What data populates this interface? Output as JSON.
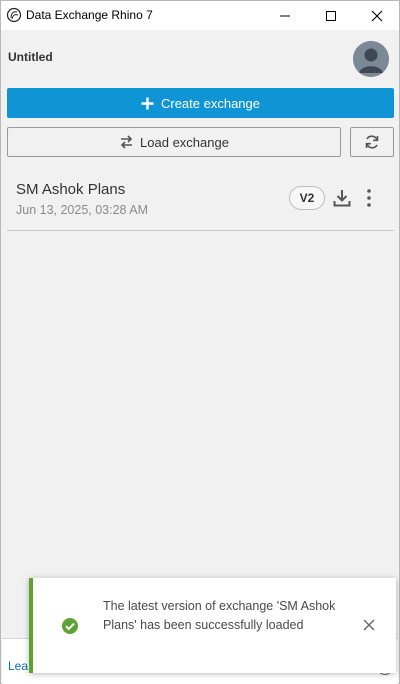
{
  "window": {
    "title": "Data Exchange Rhino 7"
  },
  "header": {
    "doc_title": "Untitled"
  },
  "actions": {
    "create_label": "Create exchange",
    "load_label": "Load exchange"
  },
  "exchanges": [
    {
      "name": "SM Ashok Plans",
      "date": "Jun 13, 2025, 03:28 AM",
      "version": "V2"
    }
  ],
  "footer": {
    "link_label": "Lea"
  },
  "toast": {
    "message": "The latest version of exchange 'SM Ashok Plans' has been successfully loaded",
    "status": "success",
    "accent_color": "#5ea234"
  },
  "colors": {
    "primary": "#0f95d6",
    "success": "#5ea234"
  },
  "icons": {
    "app": "rhino-logo-icon",
    "avatar": "user-avatar-icon",
    "create": "plus-icon",
    "load": "swap-arrows-icon",
    "refresh": "refresh-icon",
    "download": "download-icon",
    "more": "more-vertical-icon",
    "toast_status": "check-circle-icon",
    "toast_close": "close-icon"
  }
}
